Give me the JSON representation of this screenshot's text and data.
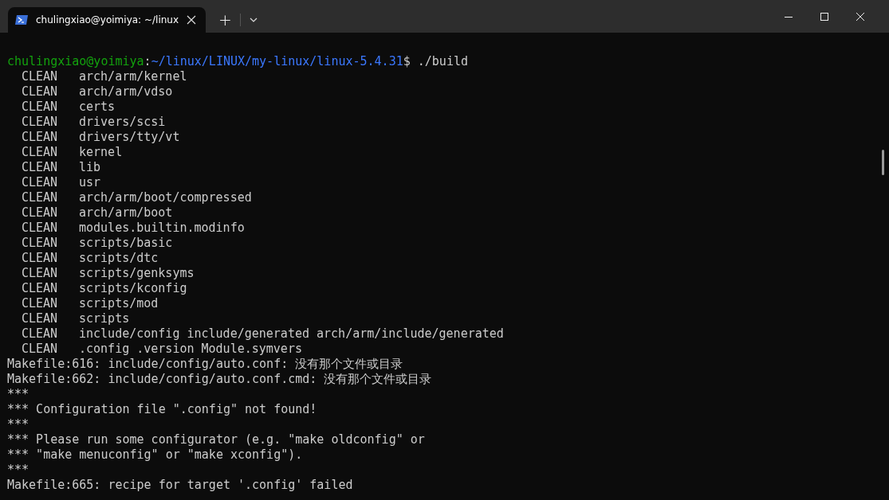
{
  "tab": {
    "title": "chulingxiao@yoimiya: ~/linux",
    "selected": true
  },
  "tab_bar": {
    "new_tab": "+"
  },
  "terminal": {
    "lines": [
      {
        "kind": "prompt",
        "user": "chulingxiao@yoimiya",
        "sep": ":",
        "path": "~/linux/LINUX/my-linux/linux-5.4.31",
        "command": "$ ./build"
      },
      {
        "kind": "clean",
        "action": "CLEAN",
        "target": "arch/arm/kernel"
      },
      {
        "kind": "clean",
        "action": "CLEAN",
        "target": "arch/arm/vdso"
      },
      {
        "kind": "clean",
        "action": "CLEAN",
        "target": "certs"
      },
      {
        "kind": "clean",
        "action": "CLEAN",
        "target": "drivers/scsi"
      },
      {
        "kind": "clean",
        "action": "CLEAN",
        "target": "drivers/tty/vt"
      },
      {
        "kind": "clean",
        "action": "CLEAN",
        "target": "kernel"
      },
      {
        "kind": "clean",
        "action": "CLEAN",
        "target": "lib"
      },
      {
        "kind": "clean",
        "action": "CLEAN",
        "target": "usr"
      },
      {
        "kind": "clean",
        "action": "CLEAN",
        "target": "arch/arm/boot/compressed"
      },
      {
        "kind": "clean",
        "action": "CLEAN",
        "target": "arch/arm/boot"
      },
      {
        "kind": "clean",
        "action": "CLEAN",
        "target": "modules.builtin.modinfo"
      },
      {
        "kind": "clean",
        "action": "CLEAN",
        "target": "scripts/basic"
      },
      {
        "kind": "clean",
        "action": "CLEAN",
        "target": "scripts/dtc"
      },
      {
        "kind": "clean",
        "action": "CLEAN",
        "target": "scripts/genksyms"
      },
      {
        "kind": "clean",
        "action": "CLEAN",
        "target": "scripts/kconfig"
      },
      {
        "kind": "clean",
        "action": "CLEAN",
        "target": "scripts/mod"
      },
      {
        "kind": "clean",
        "action": "CLEAN",
        "target": "scripts"
      },
      {
        "kind": "clean",
        "action": "CLEAN",
        "target": "include/config include/generated arch/arm/include/generated"
      },
      {
        "kind": "clean",
        "action": "CLEAN",
        "target": ".config .version Module.symvers"
      },
      {
        "kind": "text",
        "text": "Makefile:616: include/config/auto.conf: 没有那个文件或目录"
      },
      {
        "kind": "text",
        "text": "Makefile:662: include/config/auto.conf.cmd: 没有那个文件或目录"
      },
      {
        "kind": "text",
        "text": "***"
      },
      {
        "kind": "text",
        "text": "*** Configuration file \".config\" not found!"
      },
      {
        "kind": "text",
        "text": "***"
      },
      {
        "kind": "text",
        "text": "*** Please run some configurator (e.g. \"make oldconfig\" or"
      },
      {
        "kind": "text",
        "text": "*** \"make menuconfig\" or \"make xconfig\")."
      },
      {
        "kind": "text",
        "text": "***"
      },
      {
        "kind": "text",
        "text": "Makefile:665: recipe for target '.config' failed"
      }
    ]
  }
}
